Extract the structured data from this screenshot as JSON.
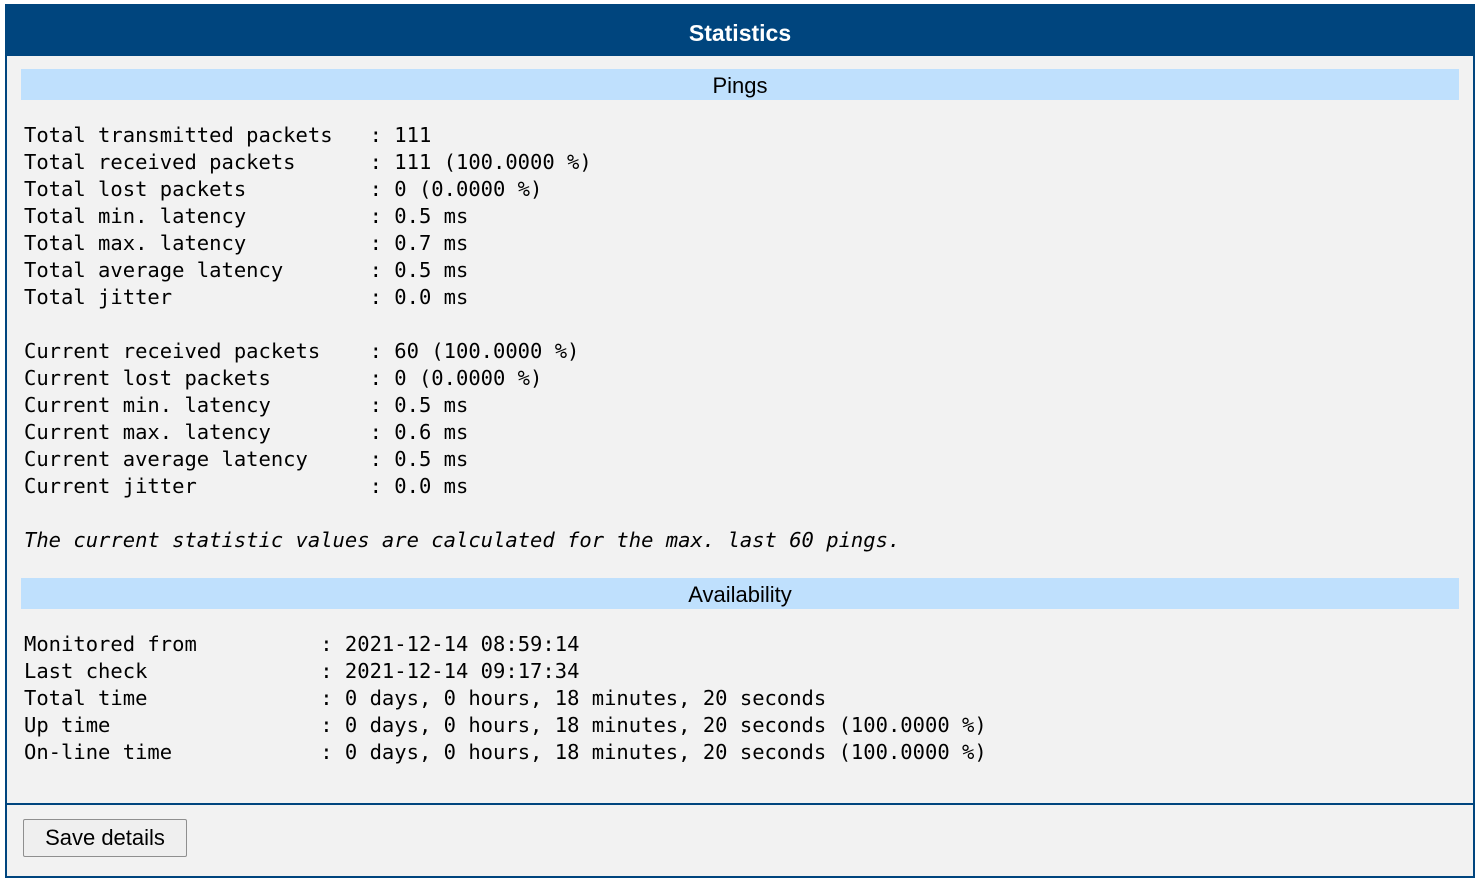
{
  "panel": {
    "title": "Statistics"
  },
  "pings": {
    "heading": "Pings",
    "total": [
      {
        "label": "Total transmitted packets",
        "value": "111"
      },
      {
        "label": "Total received packets",
        "value": "111 (100.0000 %)"
      },
      {
        "label": "Total lost packets",
        "value": "0 (0.0000 %)"
      },
      {
        "label": "Total min. latency",
        "value": "0.5 ms"
      },
      {
        "label": "Total max. latency",
        "value": "0.7 ms"
      },
      {
        "label": "Total average latency",
        "value": "0.5 ms"
      },
      {
        "label": "Total jitter",
        "value": "0.0 ms"
      }
    ],
    "current": [
      {
        "label": "Current received packets",
        "value": "60 (100.0000 %)"
      },
      {
        "label": "Current lost packets",
        "value": "0 (0.0000 %)"
      },
      {
        "label": "Current min. latency",
        "value": "0.5 ms"
      },
      {
        "label": "Current max. latency",
        "value": "0.6 ms"
      },
      {
        "label": "Current average latency",
        "value": "0.5 ms"
      },
      {
        "label": "Current jitter",
        "value": "0.0 ms"
      }
    ],
    "note": "The current statistic values are calculated for the max. last 60 pings."
  },
  "availability": {
    "heading": "Availability",
    "rows": [
      {
        "label": "Monitored from",
        "value": "2021-12-14 08:59:14"
      },
      {
        "label": "Last check",
        "value": "2021-12-14 09:17:34"
      },
      {
        "label": "Total time",
        "value": "0 days, 0 hours, 18 minutes, 20 seconds"
      },
      {
        "label": "Up time",
        "value": "0 days, 0 hours, 18 minutes, 20 seconds (100.0000 %)"
      },
      {
        "label": "On-line time",
        "value": "0 days, 0 hours, 18 minutes, 20 seconds (100.0000 %)"
      }
    ]
  },
  "footer": {
    "save_label": "Save details"
  }
}
